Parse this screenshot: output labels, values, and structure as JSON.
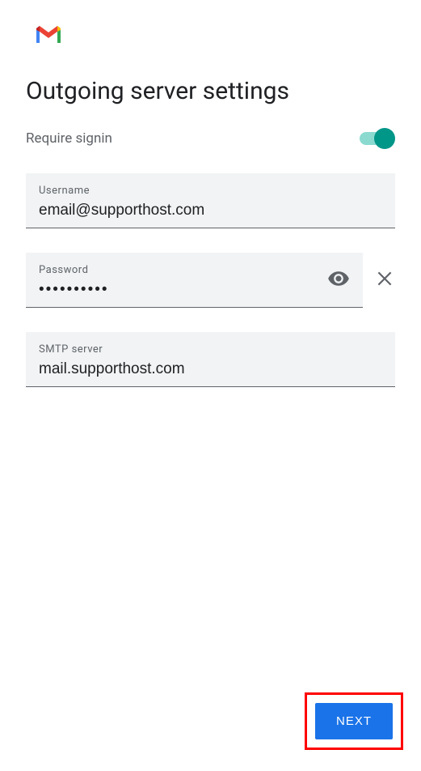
{
  "title": "Outgoing server settings",
  "signin": {
    "label": "Require signin",
    "enabled": true
  },
  "fields": {
    "username": {
      "label": "Username",
      "value": "email@supporthost.com"
    },
    "password": {
      "label": "Password",
      "value": "••••••••••"
    },
    "smtp": {
      "label": "SMTP server",
      "value": "mail.supporthost.com"
    }
  },
  "buttons": {
    "next": "NEXT"
  }
}
